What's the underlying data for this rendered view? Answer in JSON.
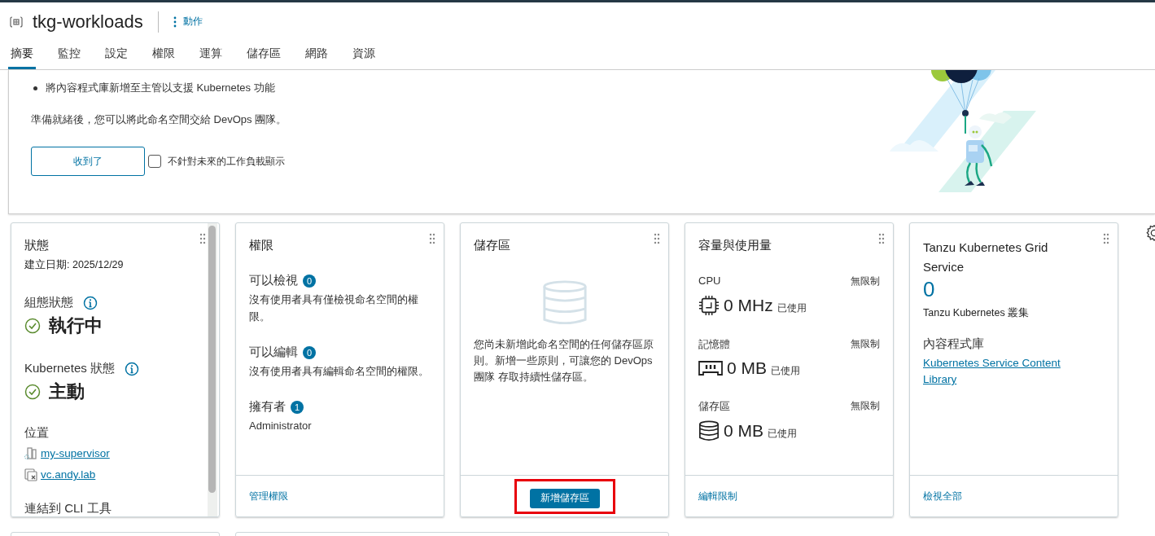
{
  "header": {
    "title": "tkg-workloads",
    "actions_label": "動作"
  },
  "tabs": [
    {
      "label": "摘要",
      "selected": true
    },
    {
      "label": "監控",
      "selected": false
    },
    {
      "label": "設定",
      "selected": false
    },
    {
      "label": "權限",
      "selected": false
    },
    {
      "label": "運算",
      "selected": false
    },
    {
      "label": "儲存區",
      "selected": false
    },
    {
      "label": "網路",
      "selected": false
    },
    {
      "label": "資源",
      "selected": false
    }
  ],
  "banner": {
    "bullets": [
      "將內容程式庫新增至主管以支援 Kubernetes 功能"
    ],
    "note": "準備就緒後，您可以將此命名空間交給 DevOps 團隊。",
    "button": "收到了",
    "checkbox": {
      "label": "不針對未來的工作負載顯示",
      "checked": false
    }
  },
  "status_card": {
    "title": "狀態",
    "created": "建立日期: 2025/12/29",
    "states": [
      {
        "label": "組態狀態",
        "value": "執行中"
      },
      {
        "label": "Kubernetes 狀態",
        "value": "主動"
      }
    ],
    "location_label": "位置",
    "locations": [
      {
        "kind": "supervisor",
        "text": "my-supervisor"
      },
      {
        "kind": "vcenter",
        "text": "vc.andy.lab"
      }
    ],
    "cli_label": "連結到 CLI 工具"
  },
  "permissions_card": {
    "title": "權限",
    "groups": [
      {
        "label": "可以檢視",
        "count": "0",
        "text": "沒有使用者具有僅檢視命名空間的權限。"
      },
      {
        "label": "可以編輯",
        "count": "0",
        "text": "沒有使用者具有編輯命名空間的權限。"
      },
      {
        "label": "擁有者",
        "count": "1",
        "text": "Administrator"
      }
    ],
    "footer_link": "管理權限"
  },
  "storage_card": {
    "title": "儲存區",
    "text": "您尚未新增此命名空間的任何儲存區原則。新增一些原則，可讓您的 DevOps 團隊 存取持續性儲存區。",
    "button": "新增儲存區",
    "highlighted": true
  },
  "capacity_card": {
    "title": "容量與使用量",
    "rows": [
      {
        "kind": "cpu",
        "label": "CPU",
        "limit": "無限制",
        "value": "0 MHz",
        "unit": "已使用"
      },
      {
        "kind": "memory",
        "label": "記憶體",
        "limit": "無限制",
        "value": "0 MB",
        "unit": "已使用"
      },
      {
        "kind": "storage",
        "label": "儲存區",
        "limit": "無限制",
        "value": "0 MB",
        "unit": "已使用"
      }
    ],
    "footer_link": "編輯限制"
  },
  "tkg_card": {
    "title": "Tanzu Kubernetes Grid Service",
    "count": "0",
    "count_label": "Tanzu Kubernetes 叢集",
    "library_label": "內容程式庫",
    "library_link": "Kubernetes Service Content Library",
    "footer_link": "檢視全部"
  }
}
